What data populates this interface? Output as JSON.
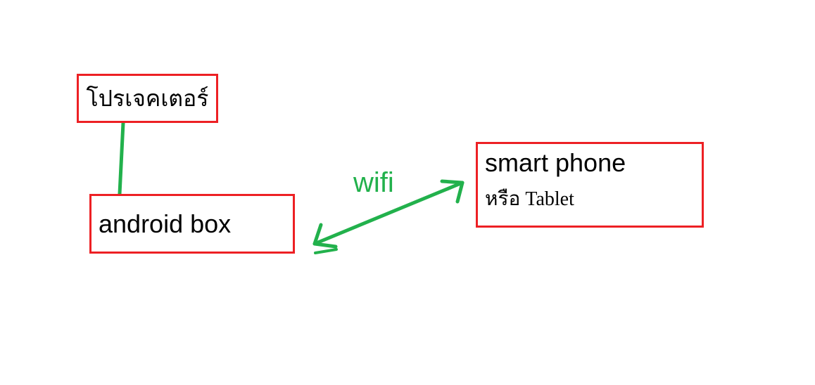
{
  "nodes": {
    "projector": {
      "label": "โปรเจคเตอร์"
    },
    "android_box": {
      "label": "android box"
    },
    "smartphone": {
      "line1": "smart phone",
      "line2": "หรือ Tablet"
    }
  },
  "edges": {
    "wifi": {
      "label": "wifi"
    }
  },
  "colors": {
    "box_border": "#ed2024",
    "connector": "#22b14c"
  }
}
